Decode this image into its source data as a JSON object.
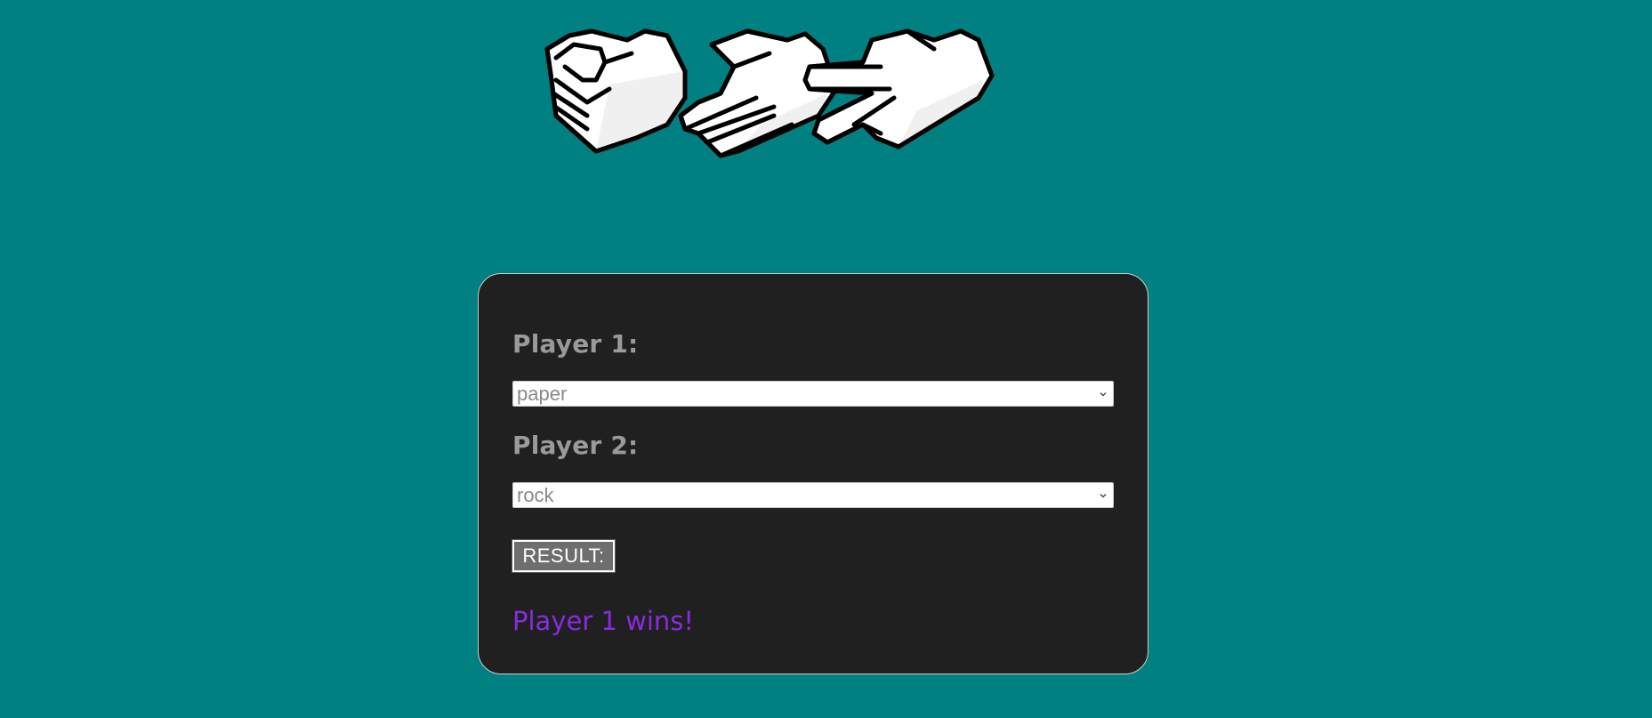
{
  "hero": {
    "icon": "rock-paper-scissors-hands-icon"
  },
  "game": {
    "player1_label": "Player 1:",
    "player1_choice": "paper",
    "player2_label": "Player 2:",
    "player2_choice": "rock",
    "result_button_label": "RESULT:",
    "outcome_text": "Player 1 wins!"
  },
  "colors": {
    "background": "#008080",
    "card": "#202020",
    "label": "#9a9a9a",
    "outcome": "#8a2be2",
    "button": "#6e6e6e"
  }
}
